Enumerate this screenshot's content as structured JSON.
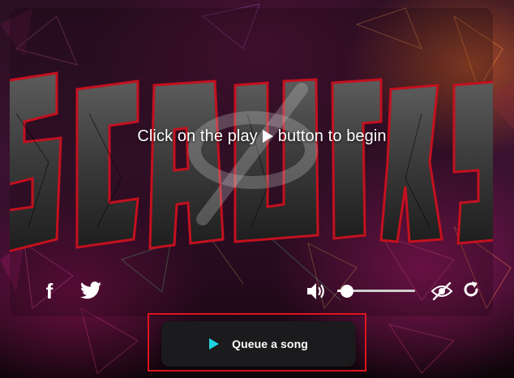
{
  "player": {
    "prompt_before": "Click on the play",
    "prompt_after": "button to begin",
    "play_icon": "play-icon",
    "background_logo_text": "SCAUTTYB"
  },
  "controls": {
    "facebook_icon": "facebook-icon",
    "facebook_glyph": "f",
    "twitter_icon": "twitter-icon",
    "volume_icon": "volume-icon",
    "volume_level": 0.12,
    "hide_icon": "eye-slash-icon",
    "refresh_icon": "refresh-icon"
  },
  "queue": {
    "label": "Queue a song",
    "icon": "play-icon",
    "icon_color": "#22d3e0",
    "highlight_color": "#e0141e"
  },
  "colors": {
    "accent": "#22d3e0",
    "button_bg": "#1b1a1c"
  }
}
